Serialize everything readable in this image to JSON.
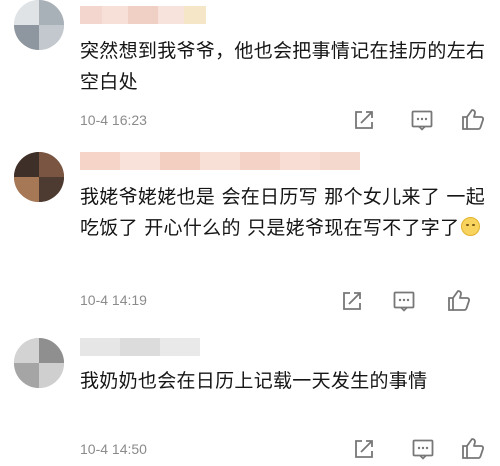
{
  "comments": [
    {
      "text": "突然想到我爷爷，他也会把事情记在挂历的左右空白处",
      "time": "10-4 16:23"
    },
    {
      "text": "我姥爷姥姥也是 会在日历写 那个女儿来了 一起吃饭了 开心什么的 只是姥爷现在写不了字了",
      "emoji": "face-emoji",
      "time": "10-4 14:19"
    },
    {
      "text": "我奶奶也会在日历上记载一天发生的事情",
      "time": "10-4 14:50"
    }
  ],
  "icons": {
    "share": "share-icon",
    "comment": "comment-icon",
    "like": "thumbs-up-icon"
  }
}
